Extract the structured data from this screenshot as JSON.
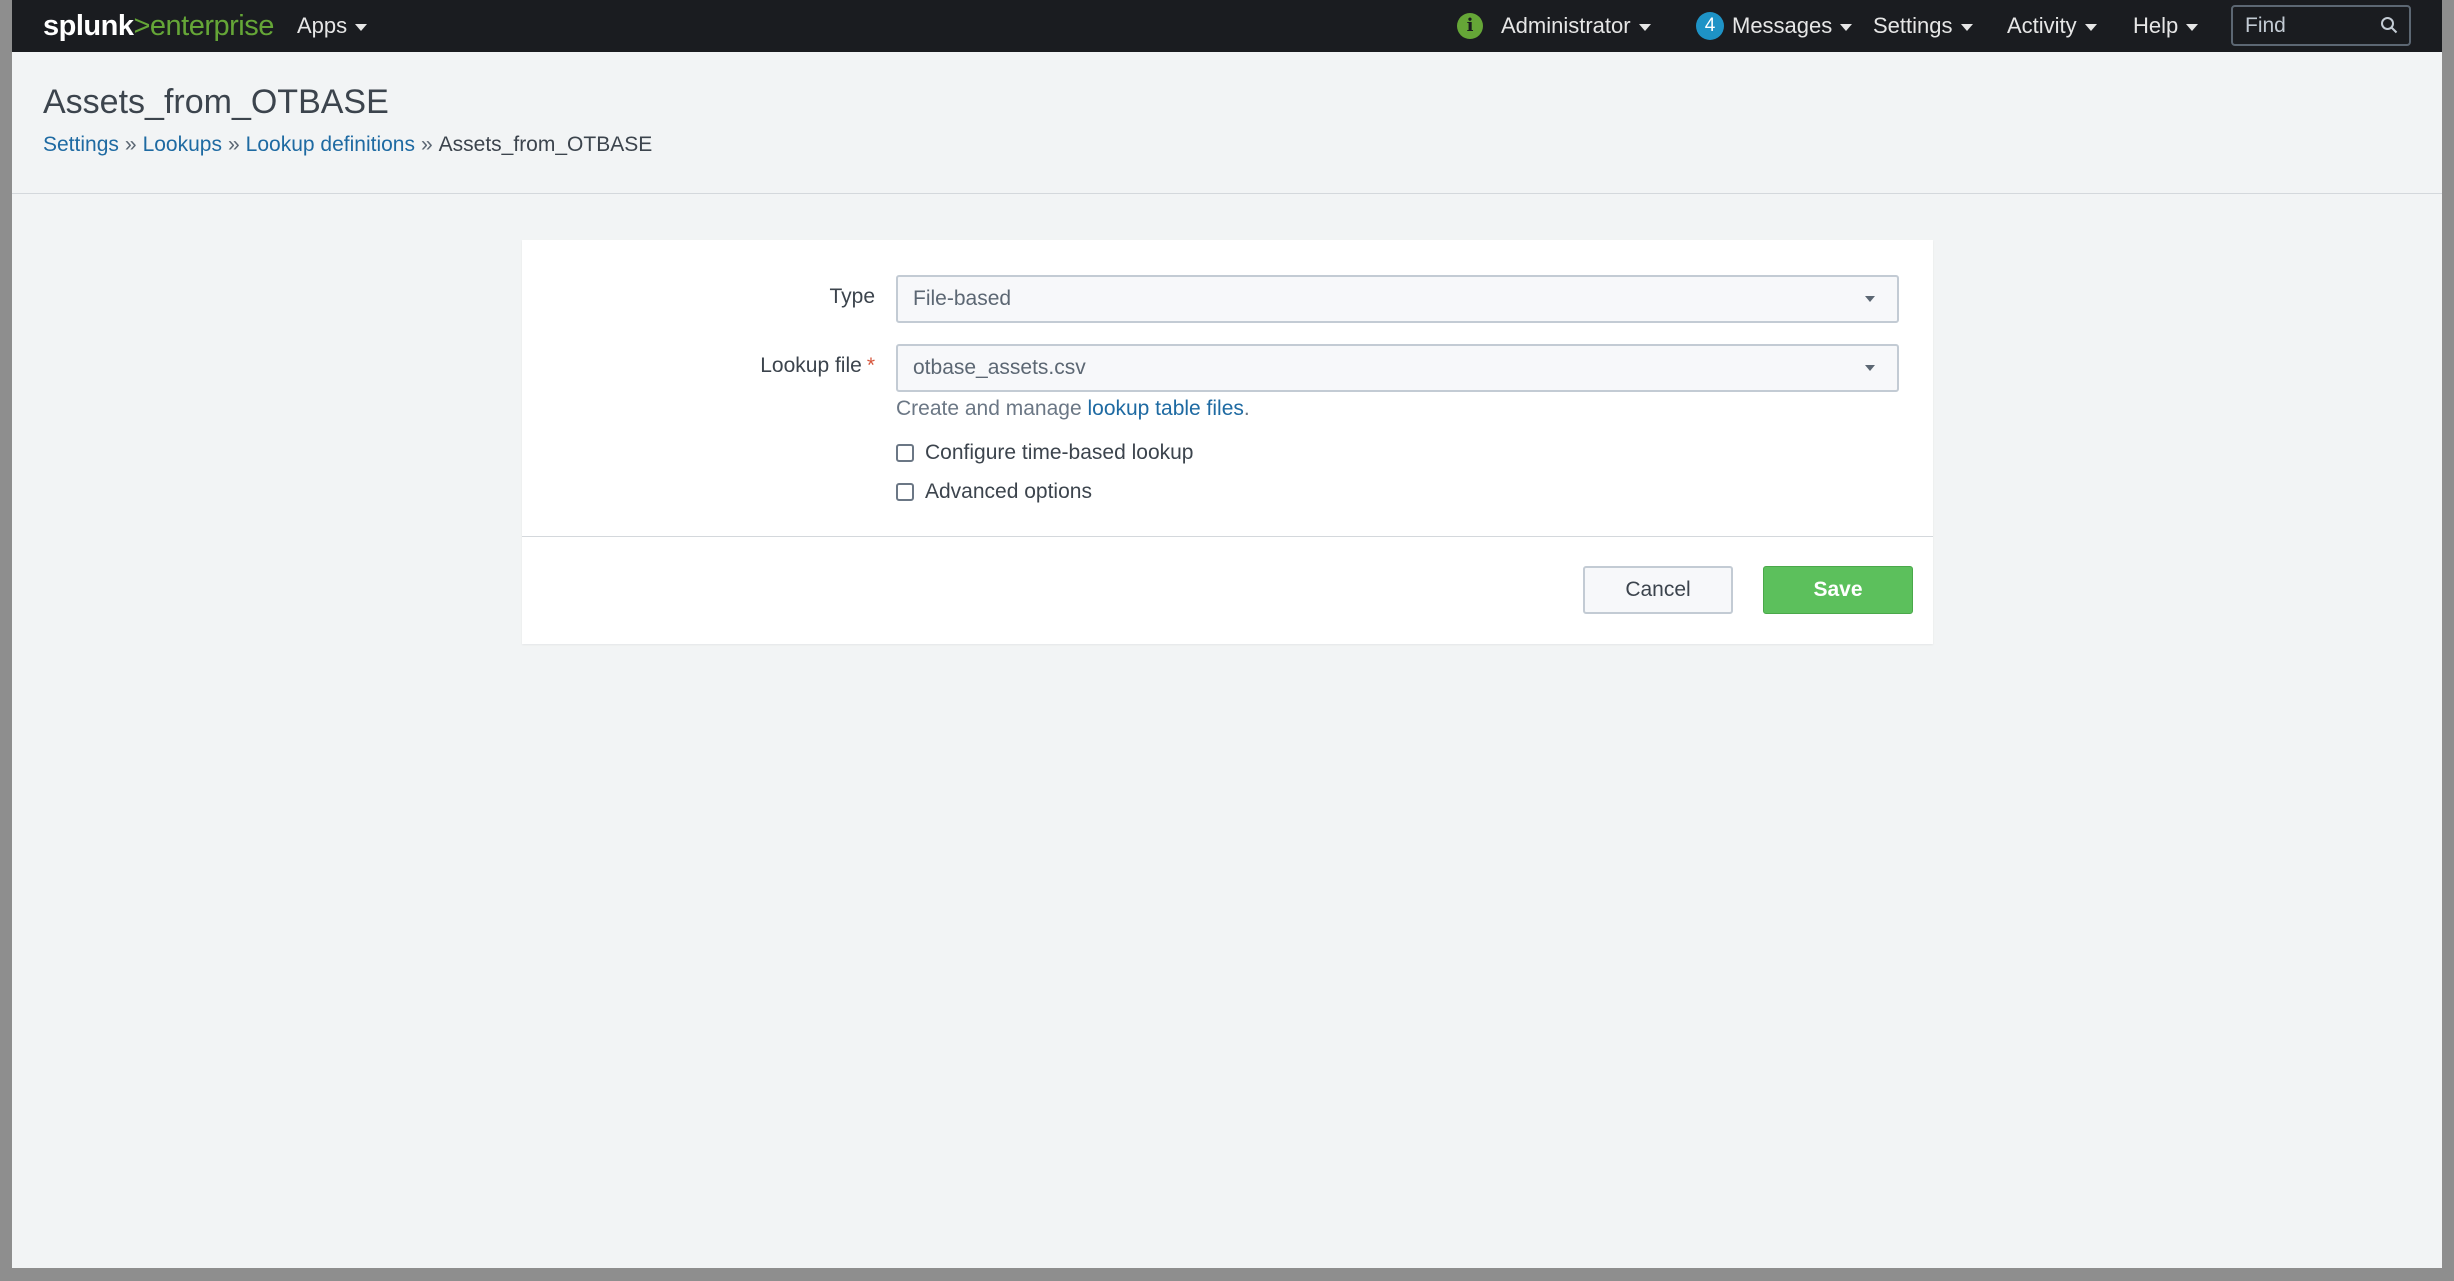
{
  "topbar": {
    "logo_brand": "splunk",
    "logo_gt": ">",
    "logo_product": "enterprise",
    "apps_label": "Apps",
    "user_label": "Administrator",
    "messages_count": "4",
    "messages_label": "Messages",
    "settings_label": "Settings",
    "activity_label": "Activity",
    "help_label": "Help",
    "find_placeholder": "Find"
  },
  "header": {
    "title": "Assets_from_OTBASE",
    "breadcrumb": {
      "settings": "Settings",
      "lookups": "Lookups",
      "lookup_definitions": "Lookup definitions",
      "current": "Assets_from_OTBASE",
      "separator": "»"
    }
  },
  "form": {
    "type_label": "Type",
    "type_value": "File-based",
    "lookup_file_label": "Lookup file",
    "required_marker": "*",
    "lookup_file_value": "otbase_assets.csv",
    "help_prefix": "Create and manage ",
    "help_link": "lookup table files",
    "help_suffix": ".",
    "time_based_label": "Configure time-based lookup",
    "advanced_label": "Advanced options",
    "cancel_label": "Cancel",
    "save_label": "Save"
  },
  "colors": {
    "topbar_bg": "#1a1c20",
    "brand_green": "#65a637",
    "link_blue": "#1e6aa2",
    "save_green": "#5cc05c",
    "badge_blue": "#1e93c6"
  }
}
